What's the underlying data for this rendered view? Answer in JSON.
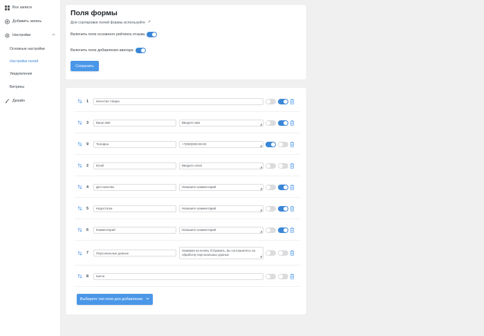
{
  "colors": {
    "accent": "#3a86d6",
    "button": "#4a97e8",
    "toggle_off": "#dcdcde"
  },
  "sidebar": {
    "items": [
      {
        "label": "Все записи",
        "icon": "list-icon"
      },
      {
        "label": "Добавить запись",
        "icon": "plus-circle-icon"
      },
      {
        "label": "Настройки",
        "icon": "gear-icon"
      },
      {
        "label": "Дизайн",
        "icon": "brush-icon"
      }
    ],
    "settings_subitems": [
      "Основные настройки",
      "Настройки полей",
      "Уведомления",
      "Витрины"
    ]
  },
  "form_card": {
    "title": "Поля формы",
    "subtitle": "Для сортировки полей формы используйте",
    "setting_rating": "Включить поле основного рейтинга отзыва",
    "setting_avatar": "Включить поле добавления аватара",
    "save_label": "Сохранить"
  },
  "fields": [
    {
      "num": "1",
      "name": "Качество товара",
      "placeholder": "",
      "toggle1": false,
      "toggle2": true
    },
    {
      "num": "3",
      "name": "Ваше имя",
      "placeholder": "Введите имя",
      "toggle1": false,
      "toggle2": true
    },
    {
      "num": "9",
      "name": "Телефон",
      "placeholder": "+7(000)000-00-00",
      "toggle1": true,
      "toggle2": false
    },
    {
      "num": "2",
      "name": "Email",
      "placeholder": "Введите email",
      "toggle1": false,
      "toggle2": false
    },
    {
      "num": "4",
      "name": "Достоинства",
      "placeholder": "Напишите комментарий",
      "toggle1": false,
      "toggle2": true
    },
    {
      "num": "5",
      "name": "Недостатки",
      "placeholder": "Напишите комментарий",
      "toggle1": false,
      "toggle2": true
    },
    {
      "num": "6",
      "name": "Комментарий",
      "placeholder": "Напишите комментарий",
      "toggle1": false,
      "toggle2": true
    },
    {
      "num": "7",
      "name": "Персональные данные",
      "placeholder": "Нажимая на кнопку Отправить, вы соглашаетесь на обработку персональных данных",
      "toggle1": false,
      "toggle2": false
    },
    {
      "num": "8",
      "name": "Капча",
      "placeholder": "",
      "toggle1": false,
      "toggle2": false
    }
  ],
  "add_field_label": "Выберите тип поля для добавления"
}
